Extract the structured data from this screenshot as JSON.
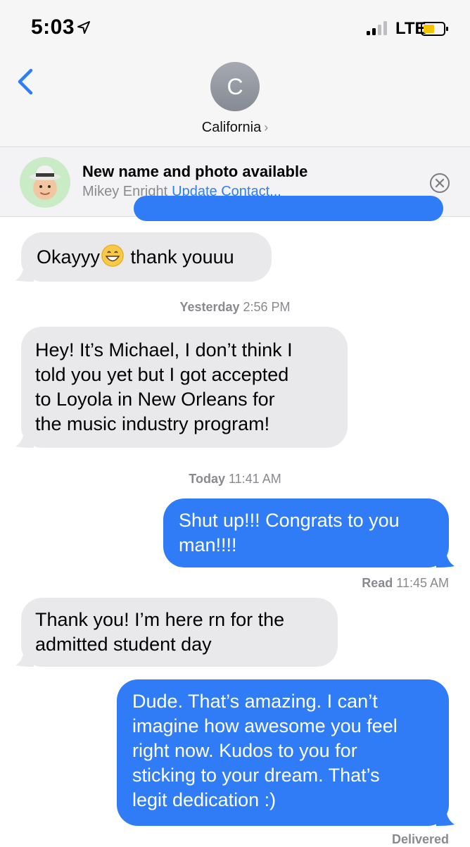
{
  "status_bar": {
    "time": "5:03",
    "network": "LTE",
    "location_icon": "location-arrow-icon",
    "signal_icon": "cellular-signal-icon",
    "battery_icon": "battery-low-icon"
  },
  "header": {
    "avatar_initial": "C",
    "contact_name": "California",
    "chevron": "›",
    "back_icon": "chevron-left-icon"
  },
  "banner": {
    "title": "New name and photo available",
    "name": "Mikey Enright",
    "action": "Update Contact...",
    "avatar_icon": "memoji-avatar-icon",
    "close_icon": "close-circle-icon"
  },
  "messages": {
    "m1": {
      "before_emoji": "Okayyy",
      "after_emoji": " thank youuu",
      "emoji": "grinning-face-icon"
    },
    "stamp1": {
      "day": "Yesterday",
      "time": "2:56 PM"
    },
    "m2": {
      "lines": [
        "Hey! It’s Michael, I don’t think I",
        "told you yet but I got accepted",
        "to Loyola in New Orleans for",
        "the music industry program!"
      ]
    },
    "stamp2": {
      "day": "Today",
      "time": "11:41 AM"
    },
    "m3": {
      "lines": [
        "Shut up!!! Congrats to you",
        "man!!!!"
      ]
    },
    "receipt1": {
      "label": "Read",
      "time": "11:45 AM"
    },
    "m4": {
      "lines": [
        "Thank you! I’m here rn for the",
        "admitted student day"
      ]
    },
    "m5": {
      "lines": [
        "Dude. That’s amazing. I can’t",
        "imagine how awesome you feel",
        "right now. Kudos to you for",
        "sticking to your dream. That’s",
        "legit dedication :)"
      ]
    },
    "receipt2": {
      "label": "Delivered"
    }
  },
  "colors": {
    "outgoing_bubble": "#2f7cf6",
    "incoming_bubble": "#e9e9eb",
    "link": "#2f7ef5",
    "battery_level": "#f5c400"
  }
}
